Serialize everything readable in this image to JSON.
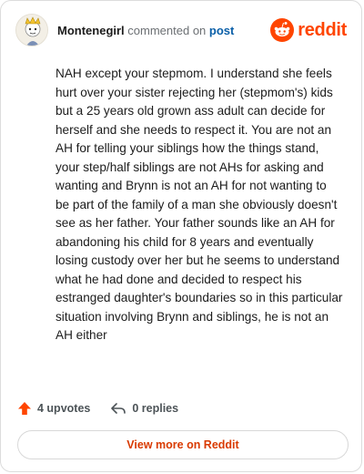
{
  "header": {
    "username": "Montenegirl",
    "action_text": "commented on",
    "post_link": "post",
    "brand": "reddit"
  },
  "comment": {
    "text": "NAH except your stepmom. I understand she feels hurt over your sister rejecting her (stepmom's) kids but a 25 years old grown ass adult can decide for herself and she needs to respect it. You are not an AH for telling your siblings how the things stand, your step/half siblings are not AHs for asking and wanting and Brynn is not an AH for not wanting to be part of the family of a man she obviously doesn't see as her father. Your father sounds like an AH for abandoning his child for 8 years and eventually losing custody over her but he seems to understand what he had done and decided to respect his estranged daughter's boundaries so in this particular situation involving Brynn and siblings, he is not an AH either"
  },
  "actions": {
    "upvotes": "4 upvotes",
    "replies": "0 replies"
  },
  "footer": {
    "view_more": "View more on Reddit"
  },
  "colors": {
    "accent": "#ff4500",
    "link": "#0a5fa8",
    "cta": "#d93a00"
  }
}
